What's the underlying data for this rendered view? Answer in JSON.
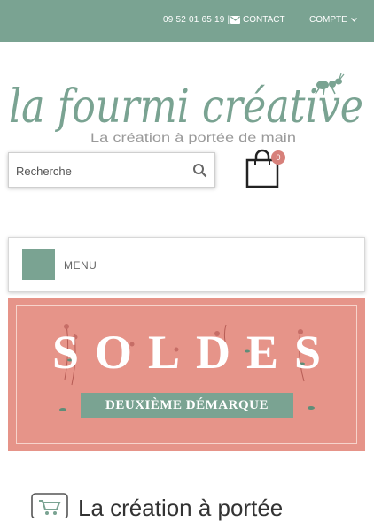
{
  "topbar": {
    "phone": "09 52 01 65 19 |",
    "contact_label": "CONTACT",
    "account_label": "COMPTE",
    "bg_color": "#7aa392"
  },
  "logo": {
    "title": "la fourmi créative",
    "subtitle": "La création à portée de main"
  },
  "search": {
    "placeholder": "Recherche",
    "icon": "search-icon"
  },
  "cart": {
    "icon": "shopping-bag-icon",
    "count": "0",
    "badge_color": "#d7807a"
  },
  "menu": {
    "label": "MENU",
    "icon": "hamburger-icon"
  },
  "banner": {
    "headline": "SOLDES",
    "ribbon": "DEUXIÈME DÉMARQUE",
    "bg_color": "#e69489",
    "ribbon_color": "#7aa392"
  },
  "tagline": {
    "text": "La création à portée",
    "icon": "cart-icon"
  }
}
